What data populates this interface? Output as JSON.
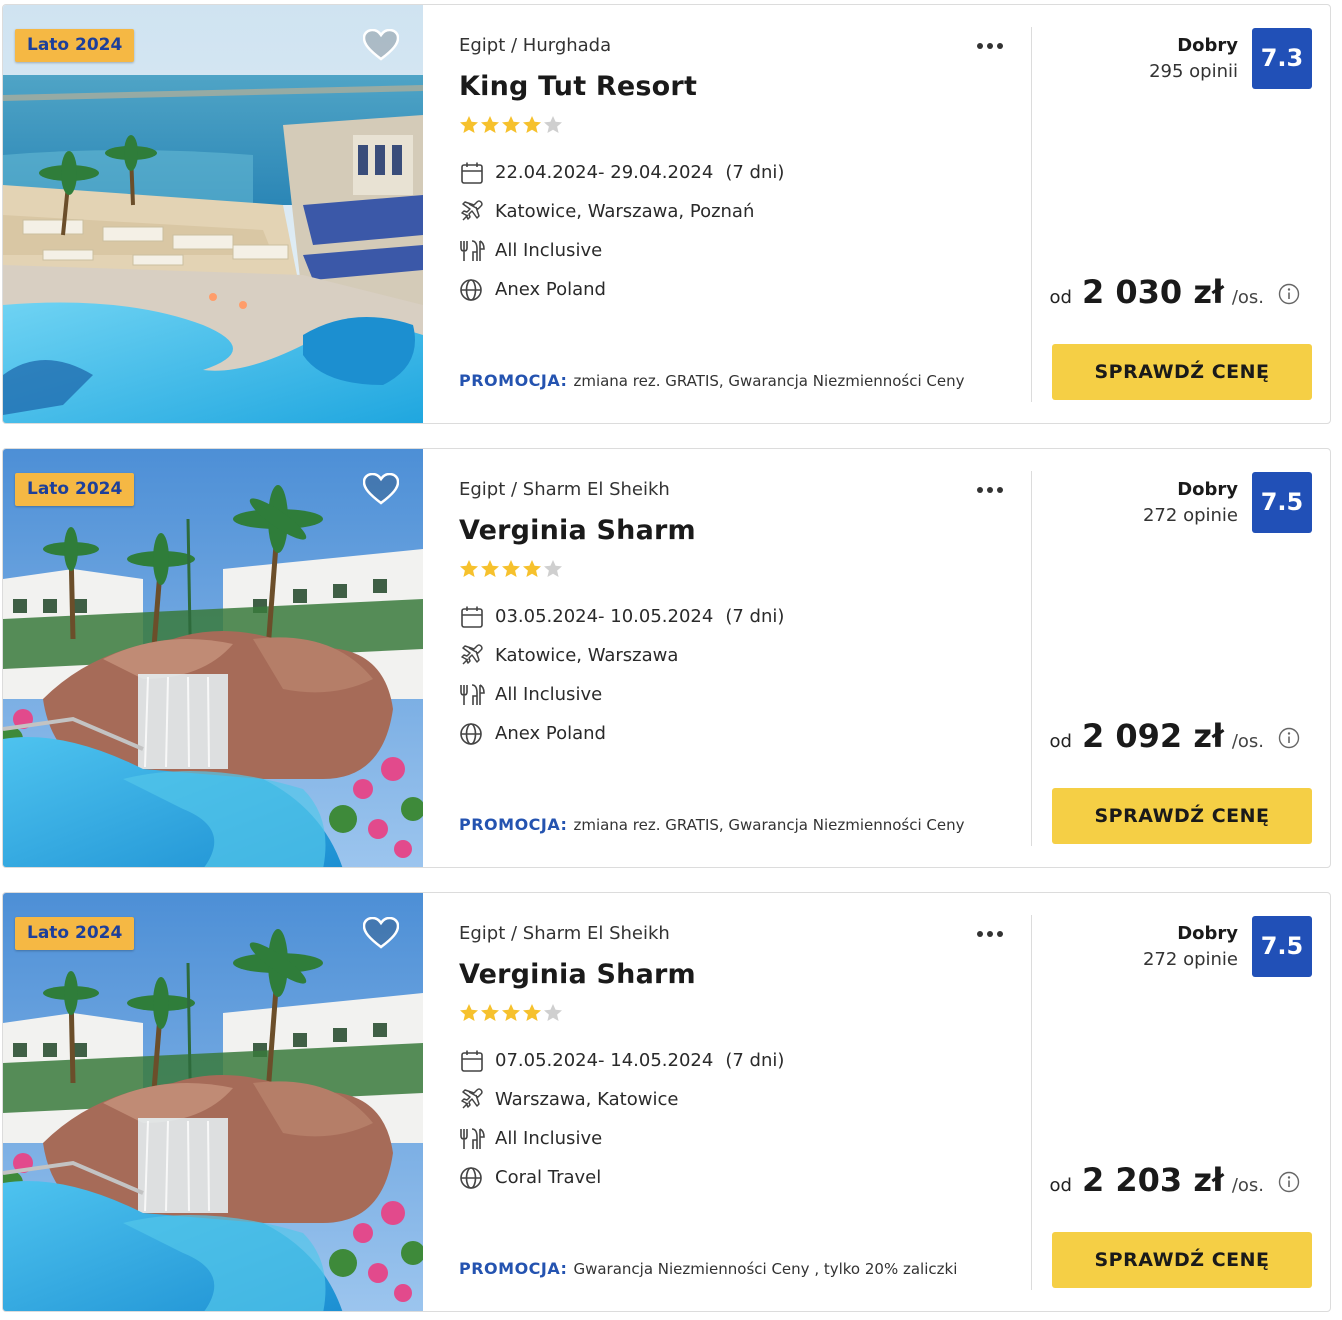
{
  "offers": [
    {
      "badge": "Lato 2024",
      "location": "Egipt / Hurghada",
      "name": "King Tut Resort",
      "stars": 4,
      "dates": "22.04.2024- 29.04.2024",
      "duration": "(7 dni)",
      "departures": "Katowice, Warszawa, Poznań",
      "board": "All Inclusive",
      "operator": "Anex Poland",
      "promo_label": "PROMOCJA:",
      "promo_text": "zmiana rez. GRATIS, Gwarancja Niezmienności Ceny",
      "rating_word": "Dobry",
      "rating_count": "295 opinii",
      "score": "7.3",
      "price_from": "od",
      "price": "2 030 zł",
      "price_per": "/os.",
      "button": "SPRAWDŹ CENĘ",
      "image": "resort-beach-pool"
    },
    {
      "badge": "Lato 2024",
      "location": "Egipt / Sharm El Sheikh",
      "name": "Verginia Sharm",
      "stars": 4,
      "dates": "03.05.2024- 10.05.2024",
      "duration": "(7 dni)",
      "departures": "Katowice, Warszawa",
      "board": "All Inclusive",
      "operator": "Anex Poland",
      "promo_label": "PROMOCJA:",
      "promo_text": "zmiana rez. GRATIS, Gwarancja Niezmienności Ceny",
      "rating_word": "Dobry",
      "rating_count": "272 opinie",
      "score": "7.5",
      "price_from": "od",
      "price": "2 092 zł",
      "price_per": "/os.",
      "button": "SPRAWDŹ CENĘ",
      "image": "pool-waterfall"
    },
    {
      "badge": "Lato 2024",
      "location": "Egipt / Sharm El Sheikh",
      "name": "Verginia Sharm",
      "stars": 4,
      "dates": "07.05.2024- 14.05.2024",
      "duration": "(7 dni)",
      "departures": "Warszawa, Katowice",
      "board": "All Inclusive",
      "operator": "Coral Travel",
      "promo_label": "PROMOCJA:",
      "promo_text": "Gwarancja Niezmienności Ceny , tylko 20% zaliczki",
      "rating_word": "Dobry",
      "rating_count": "272 opinie",
      "score": "7.5",
      "price_from": "od",
      "price": "2 203 zł",
      "price_per": "/os.",
      "button": "SPRAWDŹ CENĘ",
      "image": "pool-waterfall"
    }
  ],
  "colors": {
    "badge_bg": "#f5b844",
    "badge_text": "#1d3f9a",
    "score_bg": "#2150b7",
    "promo_label": "#2453b0",
    "button_bg": "#f5cf45",
    "star_on": "#f6c12d",
    "star_off": "#cfcfcf"
  },
  "icons": {
    "favorite": "heart-icon",
    "more": "more-dots-icon",
    "dates": "calendar-icon",
    "departures": "plane-icon",
    "board": "cutlery-icon",
    "operator": "globe-icon",
    "price_info": "info-icon"
  }
}
